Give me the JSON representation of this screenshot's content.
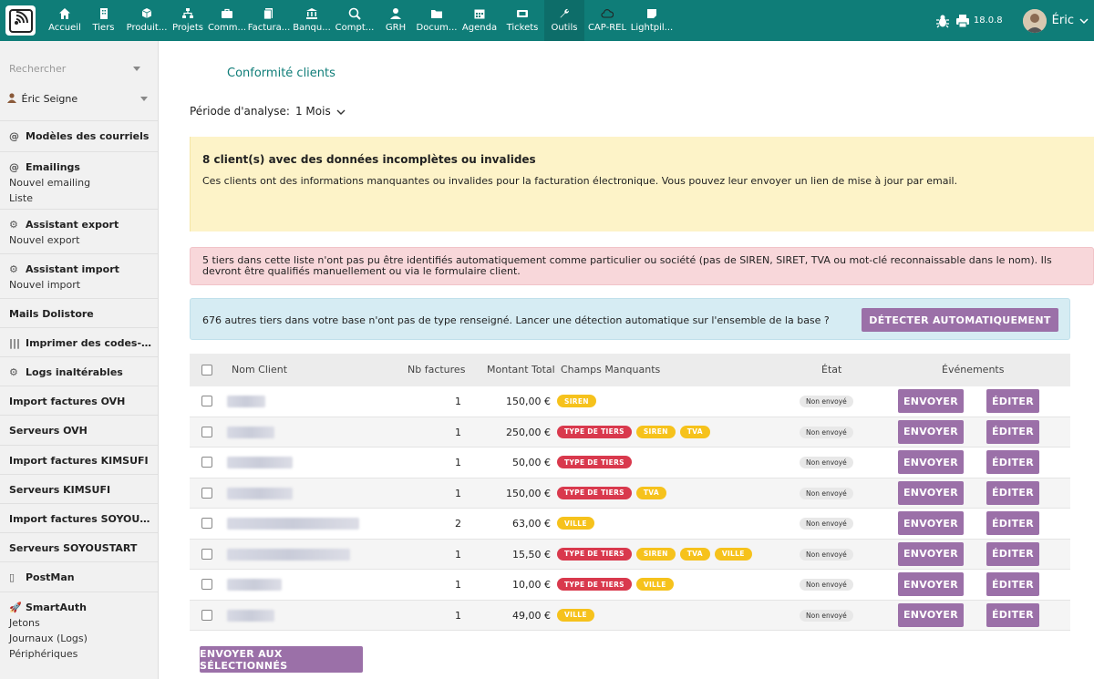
{
  "topbar": {
    "menu": [
      {
        "label": "Accueil",
        "icon": "home-icon"
      },
      {
        "label": "Tiers",
        "icon": "building-icon"
      },
      {
        "label": "Produit...",
        "icon": "cube-icon"
      },
      {
        "label": "Projets",
        "icon": "sitemap-icon"
      },
      {
        "label": "Comm...",
        "icon": "briefcase-icon"
      },
      {
        "label": "Factura...",
        "icon": "invoice-icon"
      },
      {
        "label": "Banqu...",
        "icon": "bank-icon"
      },
      {
        "label": "Compt...",
        "icon": "search-dollar-icon"
      },
      {
        "label": "GRH",
        "icon": "user-tie-icon"
      },
      {
        "label": "Docum...",
        "icon": "folder-icon"
      },
      {
        "label": "Agenda",
        "icon": "calendar-icon"
      },
      {
        "label": "Tickets",
        "icon": "ticket-icon"
      },
      {
        "label": "Outils",
        "icon": "wrench-icon"
      },
      {
        "label": "CAP-REL",
        "icon": "cloud-icon"
      },
      {
        "label": "Lightpil...",
        "icon": "sticky-note-icon"
      }
    ],
    "version": "18.0.8",
    "user_name": "Éric"
  },
  "sidebar": {
    "search_placeholder": "Rechercher",
    "user_select": "Éric Seigne",
    "blocks": [
      {
        "title": "Modèles des courriels",
        "icon": "@",
        "subs": []
      },
      {
        "title": "Emailings",
        "icon": "@",
        "subs": [
          "Nouvel emailing",
          "Liste"
        ]
      },
      {
        "title": "Assistant export",
        "icon": "⚙",
        "subs": [
          "Nouvel export"
        ]
      },
      {
        "title": "Assistant import",
        "icon": "⚙",
        "subs": [
          "Nouvel import"
        ]
      },
      {
        "title": "Mails Dolistore",
        "icon": "",
        "subs": []
      },
      {
        "title": "Imprimer des codes-b...",
        "icon": "|||",
        "subs": []
      },
      {
        "title": "Logs inaltérables",
        "icon": "⚙",
        "subs": []
      },
      {
        "title": "Import factures OVH",
        "icon": "",
        "subs": []
      },
      {
        "title": "Serveurs OVH",
        "icon": "",
        "subs": []
      },
      {
        "title": "Import factures KIMSUFI",
        "icon": "",
        "subs": []
      },
      {
        "title": "Serveurs KIMSUFI",
        "icon": "",
        "subs": []
      },
      {
        "title": "Import factures SOYOUST...",
        "icon": "",
        "subs": []
      },
      {
        "title": "Serveurs SOYOUSTART",
        "icon": "",
        "subs": []
      },
      {
        "title": "PostMan",
        "icon": "▯",
        "subs": []
      },
      {
        "title": "SmartAuth",
        "icon": "🚀",
        "subs": [
          "Jetons",
          "Journaux (Logs)",
          "Périphériques"
        ]
      }
    ]
  },
  "main": {
    "title": "Conformité clients",
    "period_label": "Période d'analyse:",
    "period_value": "1 Mois",
    "warning_title": "8 client(s) avec des données incomplètes ou invalides",
    "warning_text": "Ces clients ont des informations manquantes ou invalides pour la facturation électronique. Vous pouvez leur envoyer un lien de mise à jour par email.",
    "error_text": "5 tiers dans cette liste n'ont pas pu être identifiés automatiquement comme particulier ou société (pas de SIREN, SIRET, TVA ou mot-clé reconnaissable dans le nom). Ils devront être qualifiés manuellement ou via le formulaire client.",
    "info_text": "676 autres tiers dans votre base n'ont pas de type renseigné. Lancer une détection automatique sur l'ensemble de la base ?",
    "detect_button": "DÉTECTER AUTOMATIQUEMENT",
    "table": {
      "headers": {
        "name": "Nom Client",
        "count": "Nb factures",
        "amount": "Montant Total",
        "fields": "Champs Manquants",
        "state": "État",
        "events": "Événements"
      },
      "send_label": "ENVOYER",
      "edit_label": "ÉDITER",
      "rows": [
        {
          "count": "1",
          "amount": "150,00 €",
          "badges": [
            {
              "text": "SIREN",
              "color": "yellow"
            }
          ],
          "state": "Non envoyé"
        },
        {
          "count": "1",
          "amount": "250,00 €",
          "badges": [
            {
              "text": "TYPE DE TIERS",
              "color": "red"
            },
            {
              "text": "SIREN",
              "color": "yellow"
            },
            {
              "text": "TVA",
              "color": "yellow"
            }
          ],
          "state": "Non envoyé"
        },
        {
          "count": "1",
          "amount": "50,00 €",
          "badges": [
            {
              "text": "TYPE DE TIERS",
              "color": "red"
            }
          ],
          "state": "Non envoyé"
        },
        {
          "count": "1",
          "amount": "150,00 €",
          "badges": [
            {
              "text": "TYPE DE TIERS",
              "color": "red"
            },
            {
              "text": "TVA",
              "color": "yellow"
            }
          ],
          "state": "Non envoyé"
        },
        {
          "count": "2",
          "amount": "63,00 €",
          "badges": [
            {
              "text": "VILLE",
              "color": "yellow"
            }
          ],
          "state": "Non envoyé"
        },
        {
          "count": "1",
          "amount": "15,50 €",
          "badges": [
            {
              "text": "TYPE DE TIERS",
              "color": "red"
            },
            {
              "text": "SIREN",
              "color": "yellow"
            },
            {
              "text": "TVA",
              "color": "yellow"
            },
            {
              "text": "VILLE",
              "color": "yellow"
            }
          ],
          "state": "Non envoyé"
        },
        {
          "count": "1",
          "amount": "10,00 €",
          "badges": [
            {
              "text": "TYPE DE TIERS",
              "color": "red"
            },
            {
              "text": "VILLE",
              "color": "yellow"
            }
          ],
          "state": "Non envoyé"
        },
        {
          "count": "1",
          "amount": "49,00 €",
          "badges": [
            {
              "text": "VILLE",
              "color": "yellow"
            }
          ],
          "state": "Non envoyé"
        }
      ]
    },
    "send_selected_button": "ENVOYER AUX SÉLECTIONNÉS"
  },
  "colors": {
    "topbar": "#0f7d78",
    "button": "#9b70a8",
    "badge_red": "#d9394d",
    "badge_yellow": "#f6c21c"
  }
}
